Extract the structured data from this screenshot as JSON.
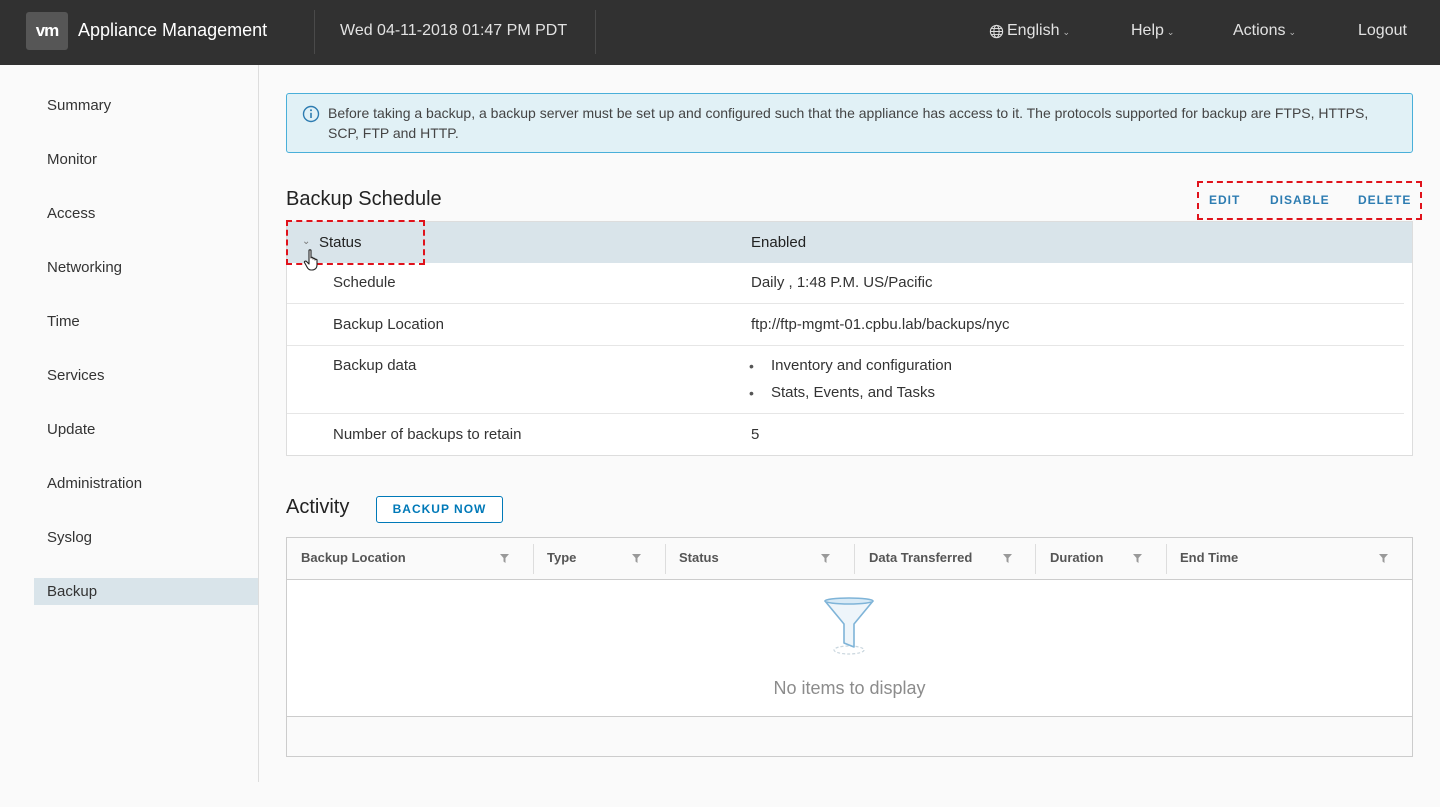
{
  "header": {
    "logo_text": "vm",
    "app_title": "Appliance Management",
    "datetime": "Wed 04-11-2018 01:47 PM PDT",
    "language": "English",
    "help": "Help",
    "actions": "Actions",
    "logout": "Logout"
  },
  "sidebar": {
    "items": [
      {
        "label": "Summary"
      },
      {
        "label": "Monitor"
      },
      {
        "label": "Access"
      },
      {
        "label": "Networking"
      },
      {
        "label": "Time"
      },
      {
        "label": "Services"
      },
      {
        "label": "Update"
      },
      {
        "label": "Administration"
      },
      {
        "label": "Syslog"
      },
      {
        "label": "Backup",
        "active": true
      }
    ]
  },
  "info_banner": {
    "text": "Before taking a backup, a backup server must be set up and configured such that the appliance has access to it. The protocols supported for backup are FTPS, HTTPS, SCP, FTP and HTTP."
  },
  "backup_schedule": {
    "title": "Backup Schedule",
    "actions": {
      "edit": "EDIT",
      "disable": "DISABLE",
      "delete": "DELETE"
    },
    "status_label": "Status",
    "status_value": "Enabled",
    "rows": {
      "schedule_label": "Schedule",
      "schedule_value": "Daily , 1:48 P.M. US/Pacific",
      "location_label": "Backup Location",
      "location_value": "ftp://ftp-mgmt-01.cpbu.lab/backups/nyc",
      "data_label": "Backup data",
      "data_values": [
        "Inventory and configuration",
        "Stats, Events, and Tasks"
      ],
      "retain_label": "Number of backups to retain",
      "retain_value": "5"
    }
  },
  "activity": {
    "title": "Activity",
    "backup_now": "BACKUP NOW",
    "columns": [
      "Backup Location",
      "Type",
      "Status",
      "Data Transferred",
      "Duration",
      "End Time"
    ],
    "empty_text": "No items to display"
  },
  "colors": {
    "header_bg": "#313131",
    "accent": "#0079b8",
    "highlight_dash": "#e0121b",
    "active_nav": "#d9e4ea"
  }
}
